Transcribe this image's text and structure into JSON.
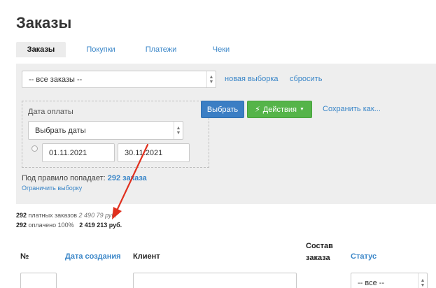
{
  "page": {
    "title": "Заказы"
  },
  "tabs": [
    {
      "label": "Заказы",
      "active": true
    },
    {
      "label": "Покупки",
      "active": false
    },
    {
      "label": "Платежи",
      "active": false
    },
    {
      "label": "Чеки",
      "active": false
    }
  ],
  "filter": {
    "orders_select": "-- все заказы --",
    "new_selection_link": "новая выборка",
    "reset_link": "сбросить",
    "date_label": "Дата оплаты",
    "dates_select": "Выбрать даты",
    "date_from": "01.11.2021",
    "date_to": "30.11.2021",
    "select_button": "Выбрать",
    "actions_button": "Действия",
    "save_link": "Сохранить как...",
    "rule_prefix": "Под правило попадает:",
    "rule_count": "292 заказа",
    "limit_link": "Ограничить выборку"
  },
  "summary": {
    "paid_count": "292",
    "paid_label": "платных заказов",
    "paid_amount": "2 490 79",
    "paid_amount_tail": "руб.",
    "paid_off_count": "292",
    "paid_off_label": "оплачено 100%",
    "paid_off_amount": "2 419 213 руб."
  },
  "table": {
    "col_num": "№",
    "col_date": "Дата создания",
    "col_client": "Клиент",
    "col_composition_1": "Состав",
    "col_composition_2": "заказа",
    "col_status": "Статус",
    "status_filter": "-- все --"
  },
  "colors": {
    "link": "#3a86c8",
    "primary_button": "#3b7ec4",
    "success_button": "#55b449",
    "arrow": "#e0301e"
  }
}
